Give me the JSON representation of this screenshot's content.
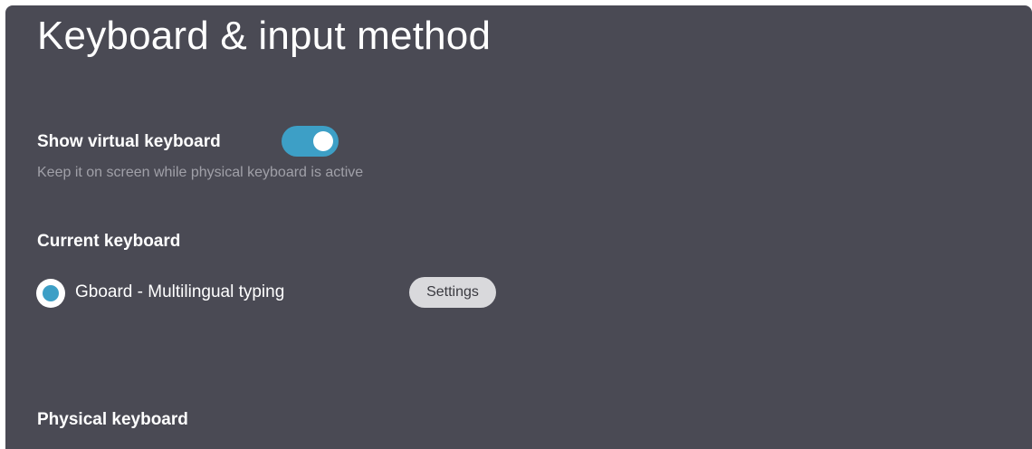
{
  "page": {
    "title": "Keyboard & input method"
  },
  "virtual_keyboard": {
    "label": "Show virtual keyboard",
    "description": "Keep it on screen while physical keyboard is active",
    "enabled": true
  },
  "current_keyboard": {
    "heading": "Current keyboard",
    "option_label": "Gboard - Multilingual typing",
    "selected": true,
    "settings_label": "Settings"
  },
  "physical_keyboard": {
    "heading": "Physical keyboard"
  },
  "colors": {
    "background": "#4a4a54",
    "accent": "#3d9fc6",
    "secondary_text": "#a0a0a8",
    "button_bg": "#d9d9dc"
  }
}
